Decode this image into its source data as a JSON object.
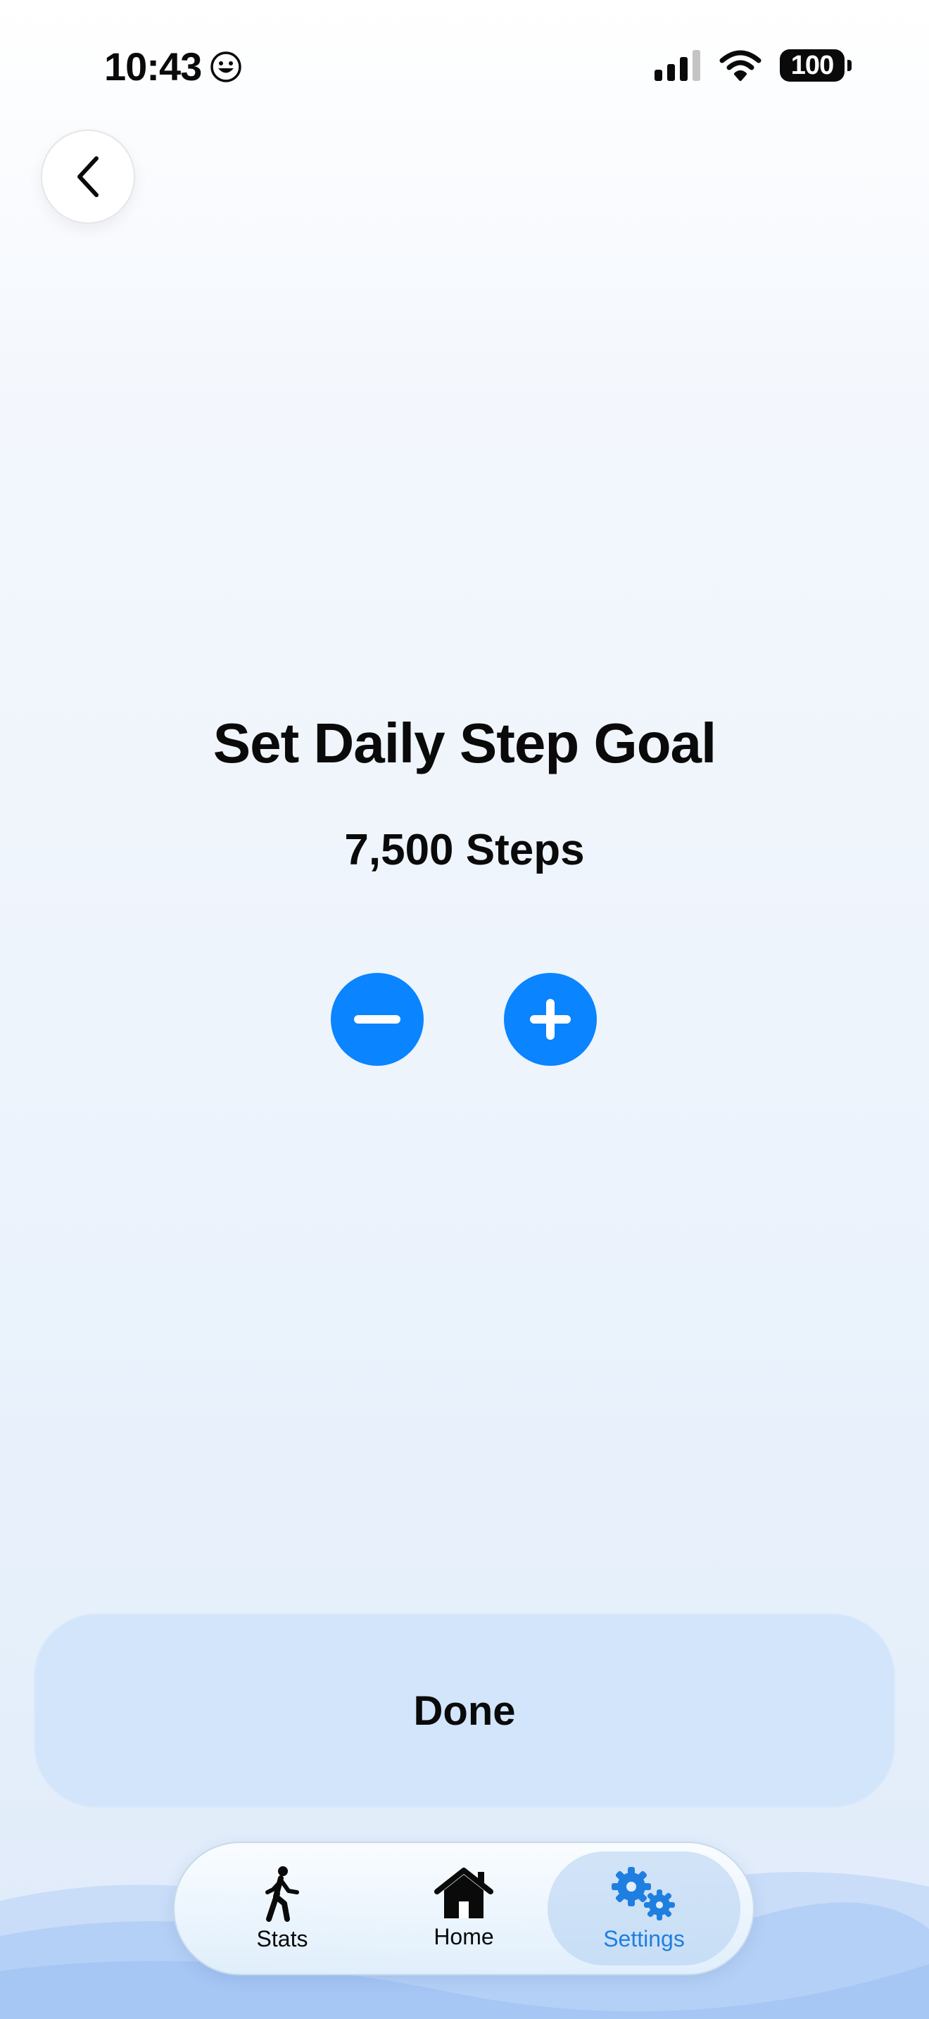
{
  "status_bar": {
    "time": "10:43",
    "battery": "100"
  },
  "screen": {
    "title": "Set Daily Step Goal",
    "goal_value": "7,500 Steps"
  },
  "actions": {
    "done_label": "Done"
  },
  "tab_bar": {
    "items": [
      {
        "label": "Stats",
        "icon": "walking-figure-icon"
      },
      {
        "label": "Home",
        "icon": "house-icon"
      },
      {
        "label": "Settings",
        "icon": "gears-icon",
        "selected": true
      }
    ]
  },
  "colors": {
    "accent": "#0a84ff",
    "selected_tab_text": "#1f7fe0",
    "done_button_bg": "#d3e5fa"
  }
}
